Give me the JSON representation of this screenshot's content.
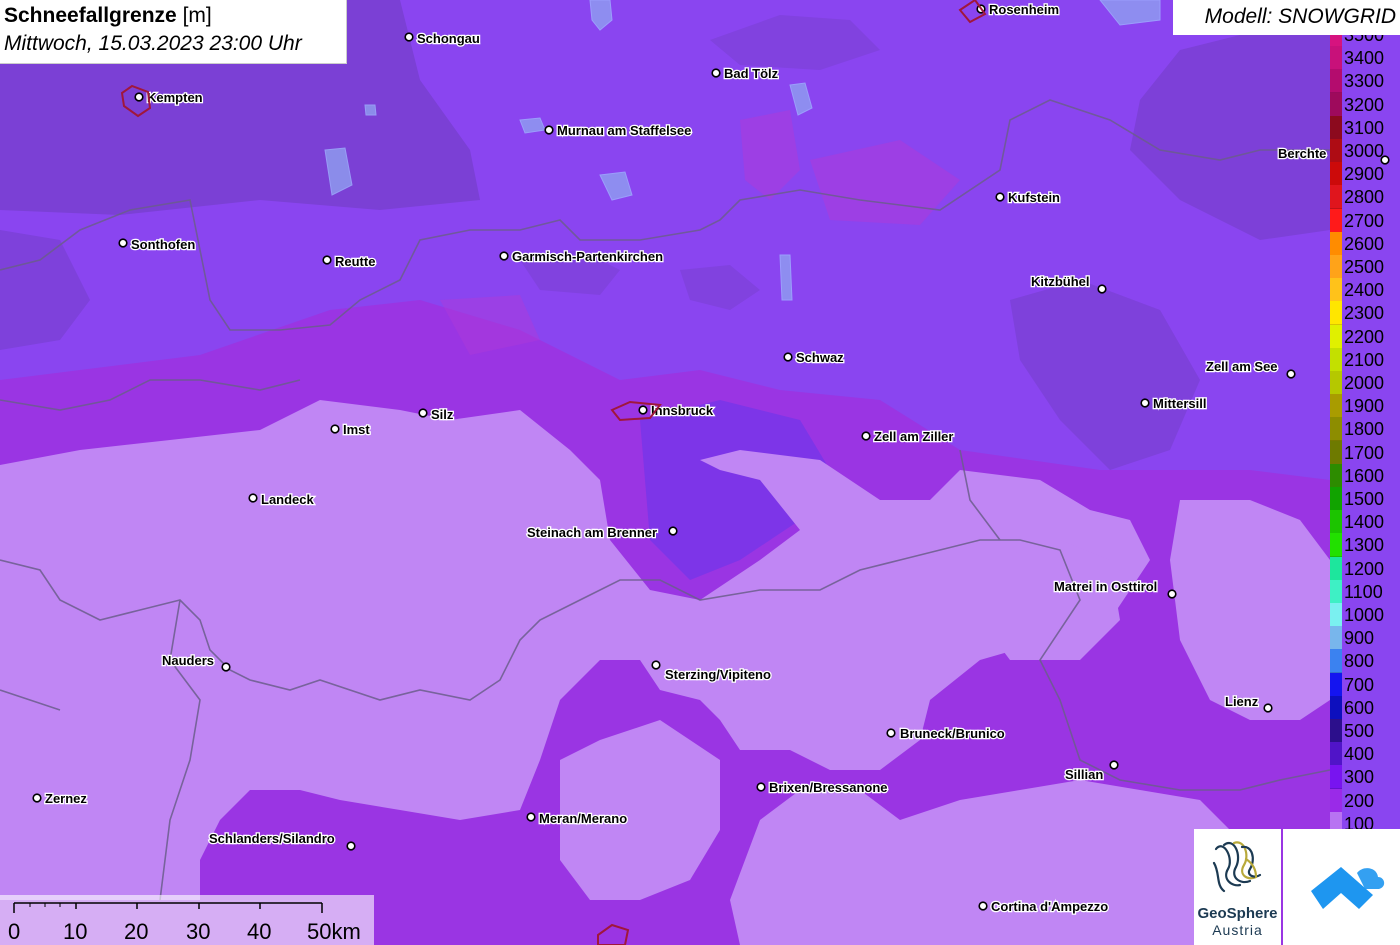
{
  "header": {
    "title_bold": "Schneefallgrenze",
    "title_unit": "[m]",
    "date": "Mittwoch, 15.03.2023 23:00 Uhr",
    "model": "Modell: SNOWGRID"
  },
  "legend": {
    "levels": [
      {
        "label": "3500",
        "color": "#d6137f"
      },
      {
        "label": "3400",
        "color": "#c8117a"
      },
      {
        "label": "3300",
        "color": "#b40c6e"
      },
      {
        "label": "3200",
        "color": "#9e0a5c"
      },
      {
        "label": "3100",
        "color": "#8c0a1e"
      },
      {
        "label": "3000",
        "color": "#ae0c14"
      },
      {
        "label": "2900",
        "color": "#cc0a0a"
      },
      {
        "label": "2800",
        "color": "#e0151d"
      },
      {
        "label": "2700",
        "color": "#ff1a1a"
      },
      {
        "label": "2600",
        "color": "#ff8c00"
      },
      {
        "label": "2500",
        "color": "#ffa319"
      },
      {
        "label": "2400",
        "color": "#ffc21a"
      },
      {
        "label": "2300",
        "color": "#ffe600"
      },
      {
        "label": "2200",
        "color": "#e0f000"
      },
      {
        "label": "2100",
        "color": "#c3e000"
      },
      {
        "label": "2000",
        "color": "#b5c800"
      },
      {
        "label": "1900",
        "color": "#a99c00"
      },
      {
        "label": "1800",
        "color": "#8d8d00"
      },
      {
        "label": "1700",
        "color": "#6e7a00"
      },
      {
        "label": "1600",
        "color": "#2d8c00"
      },
      {
        "label": "1500",
        "color": "#11a300"
      },
      {
        "label": "1400",
        "color": "#1cc400"
      },
      {
        "label": "1300",
        "color": "#22e000"
      },
      {
        "label": "1200",
        "color": "#1de69d"
      },
      {
        "label": "1100",
        "color": "#3ef0c5"
      },
      {
        "label": "1000",
        "color": "#7af0f0"
      },
      {
        "label": "900",
        "color": "#78b6ec"
      },
      {
        "label": "800",
        "color": "#3b82f0"
      },
      {
        "label": "700",
        "color": "#1414f0"
      },
      {
        "label": "600",
        "color": "#0d0fbe"
      },
      {
        "label": "500",
        "color": "#2c0f8c"
      },
      {
        "label": "400",
        "color": "#5014c8"
      },
      {
        "label": "300",
        "color": "#7814f0"
      },
      {
        "label": "200",
        "color": "#9a2ae8"
      },
      {
        "label": "100",
        "color": "#b873f2"
      }
    ]
  },
  "cities": [
    {
      "name": "Rosenheim"
    },
    {
      "name": "Schongau"
    },
    {
      "name": "Kempten"
    },
    {
      "name": "Bad Tölz"
    },
    {
      "name": "Murnau am Staffelsee"
    },
    {
      "name": "Berchte"
    },
    {
      "name": "Kufstein"
    },
    {
      "name": "Sonthofen"
    },
    {
      "name": "Reutte"
    },
    {
      "name": "Garmisch-Partenkirchen"
    },
    {
      "name": "Kitzbühel"
    },
    {
      "name": "Schwaz"
    },
    {
      "name": "Zell am See"
    },
    {
      "name": "Mittersill"
    },
    {
      "name": "Silz"
    },
    {
      "name": "Innsbruck"
    },
    {
      "name": "Imst"
    },
    {
      "name": "Zell am Ziller"
    },
    {
      "name": "Landeck"
    },
    {
      "name": "Steinach am Brenner"
    },
    {
      "name": "Matrei in Osttirol"
    },
    {
      "name": "Nauders"
    },
    {
      "name": "Sterzing/Vipiteno"
    },
    {
      "name": "Lienz"
    },
    {
      "name": "Bruneck/Brunico"
    },
    {
      "name": "Sillian"
    },
    {
      "name": "Brixen/Bressanone"
    },
    {
      "name": "Zernez"
    },
    {
      "name": "Meran/Merano"
    },
    {
      "name": "Schlanders/Silandro"
    },
    {
      "name": "Cortina d'Ampezzo"
    }
  ],
  "scale": {
    "labels": [
      "0",
      "10",
      "20",
      "30",
      "40",
      "50km"
    ]
  },
  "logos": {
    "geosphere_name": "GeoSphere",
    "geosphere_sub": "Austria"
  }
}
